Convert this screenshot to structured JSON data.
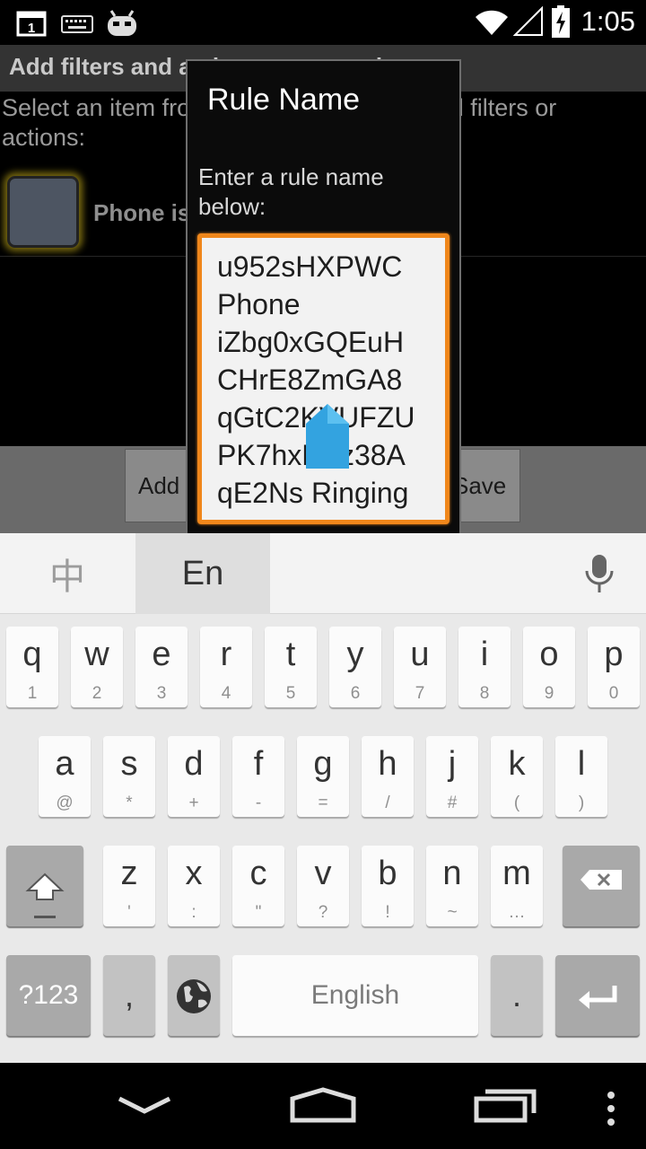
{
  "status_bar": {
    "notification_badge": "1",
    "time": "1:05",
    "icons": [
      "notification-icon",
      "keyboard-icon",
      "android-icon",
      "wifi-icon",
      "signal-icon",
      "battery-charging-icon"
    ]
  },
  "background_app": {
    "header": "Add filters and actions to your rule",
    "instructions": "Select an item from the list below, then add filters or actions:",
    "item_label": "Phone is ringing",
    "add_button": "Add",
    "save_button": "Save"
  },
  "dialog": {
    "title": "Rule Name",
    "message": "Enter a rule name below:",
    "input_value": "u952sHXPWC\nPhone\niZbg0xGQEuH\nCHrE8ZmGA8\nqGtC2KVUFZU\nPK7hxMcz38A\nqE2Ns Ringing"
  },
  "keyboard": {
    "lang_chinese": "中",
    "lang_english": "En",
    "row1": [
      {
        "main": "q",
        "sub": "1"
      },
      {
        "main": "w",
        "sub": "2"
      },
      {
        "main": "e",
        "sub": "3"
      },
      {
        "main": "r",
        "sub": "4"
      },
      {
        "main": "t",
        "sub": "5"
      },
      {
        "main": "y",
        "sub": "6"
      },
      {
        "main": "u",
        "sub": "7"
      },
      {
        "main": "i",
        "sub": "8"
      },
      {
        "main": "o",
        "sub": "9"
      },
      {
        "main": "p",
        "sub": "0"
      }
    ],
    "row2": [
      {
        "main": "a",
        "sub": "@"
      },
      {
        "main": "s",
        "sub": "*"
      },
      {
        "main": "d",
        "sub": "+"
      },
      {
        "main": "f",
        "sub": "-"
      },
      {
        "main": "g",
        "sub": "="
      },
      {
        "main": "h",
        "sub": "/"
      },
      {
        "main": "j",
        "sub": "#"
      },
      {
        "main": "k",
        "sub": "("
      },
      {
        "main": "l",
        "sub": ")"
      }
    ],
    "row3": [
      {
        "main": "z",
        "sub": "'"
      },
      {
        "main": "x",
        "sub": ":"
      },
      {
        "main": "c",
        "sub": "\""
      },
      {
        "main": "v",
        "sub": "?"
      },
      {
        "main": "b",
        "sub": "!"
      },
      {
        "main": "n",
        "sub": "~"
      },
      {
        "main": "m",
        "sub": "…"
      }
    ],
    "symbols_key": "?123",
    "comma_key": ",",
    "space_key": "English",
    "period_key": "."
  },
  "nav_bar": {
    "icons": [
      "back-icon",
      "home-icon",
      "recents-icon",
      "menu-icon"
    ]
  }
}
